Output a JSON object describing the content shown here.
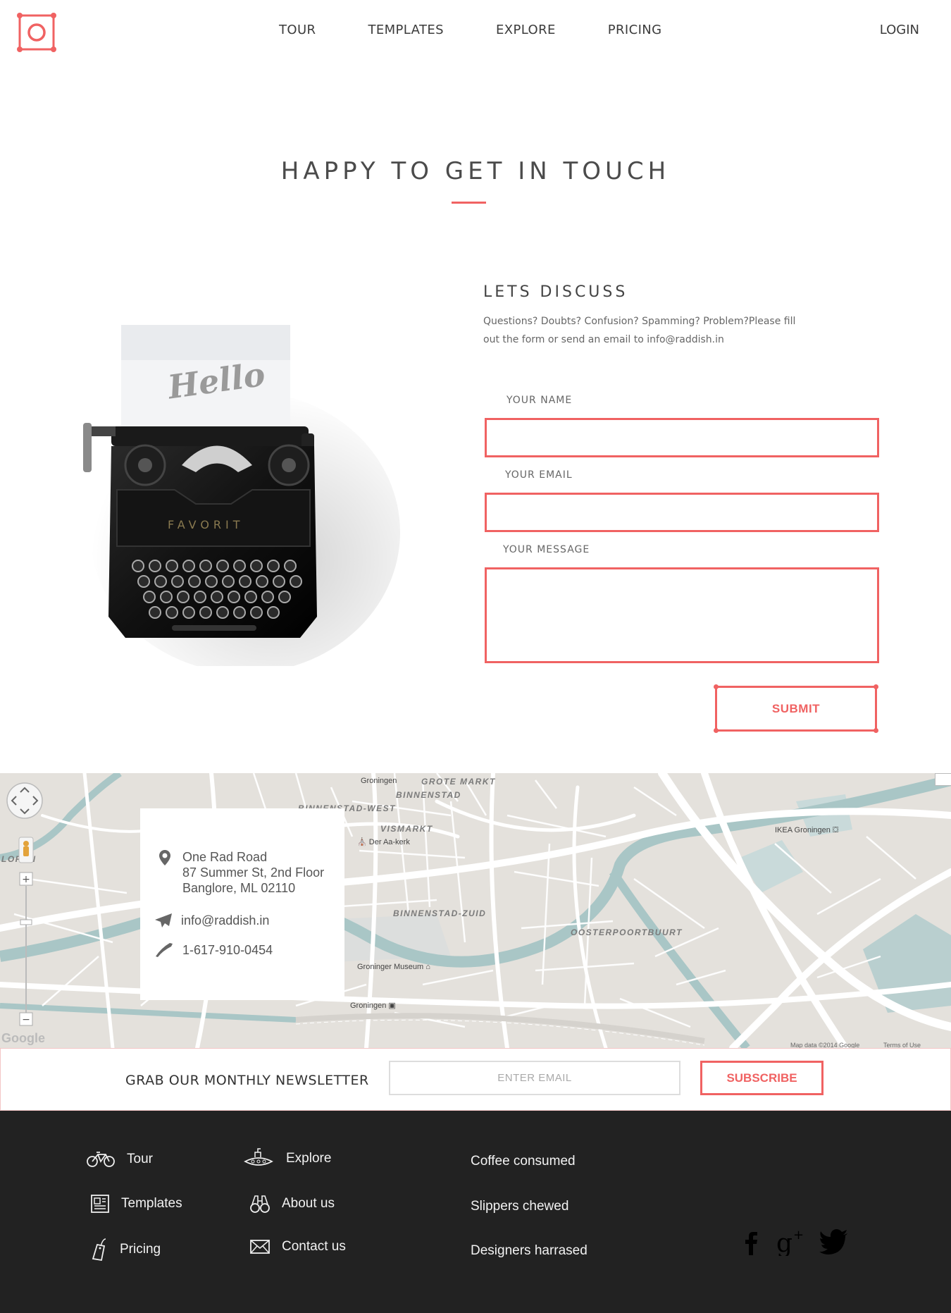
{
  "nav": {
    "links": [
      "TOUR",
      "TEMPLATES",
      "EXPLORE",
      "PRICING"
    ],
    "login": "LOGIN"
  },
  "hero": {
    "title": "HAPPY TO GET IN TOUCH",
    "accent_color": "#f06262"
  },
  "illustration": {
    "paper_text": "Hello",
    "brand_text": "FAVORIT"
  },
  "contact": {
    "title": "LETS DISCUSS",
    "text": "Questions? Doubts? Confusion? Spamming? Problem?Please fill out the form or send an email to info@raddish.in",
    "name_label": "YOUR NAME",
    "email_label": "YOUR EMAIL",
    "message_label": "YOUR MESSAGE",
    "name_value": "",
    "email_value": "",
    "message_value": "",
    "submit_label": "SUBMIT"
  },
  "map": {
    "labels": {
      "groningen_top": "Groningen",
      "grote_markt": "GROTE MARKT",
      "binnenstad": "BINNENSTAD",
      "binnenstad_west": "BINNENSTAD-WEST",
      "vismarkt": "VISMARKT",
      "der_aa_kerk": "Der Aa-kerk",
      "ikea": "IKEA Groningen",
      "binnenstad_zuid": "BINNENSTAD-ZUID",
      "oosterpoortbuurt": "OOSTERPOORTBUURT",
      "museum": "Groninger Museum",
      "station": "Groningen",
      "loren": "LOREN",
      "attribution": "Map data ©2014 Google",
      "terms": "Terms of Use",
      "google": "Google"
    },
    "address": {
      "line1": "One Rad Road",
      "line2": "87 Summer St, 2nd Floor",
      "line3": "Banglore, ML 02110",
      "email": "info@raddish.in",
      "phone": "1-617-910-0454"
    }
  },
  "newsletter": {
    "title": "GRAB OUR MONTHLY NEWSLETTER",
    "placeholder": "ENTER EMAIL",
    "button": "SUBSCRIBE"
  },
  "footer": {
    "col1": [
      "Tour",
      "Templates",
      "Pricing"
    ],
    "col2": [
      "Explore",
      "About us",
      "Contact us"
    ],
    "stats": [
      "Coffee consumed",
      "Slippers chewed",
      "Designers harrased"
    ],
    "social_icons": [
      "facebook-icon",
      "google-plus-icon",
      "twitter-icon"
    ],
    "background": "#222222"
  }
}
